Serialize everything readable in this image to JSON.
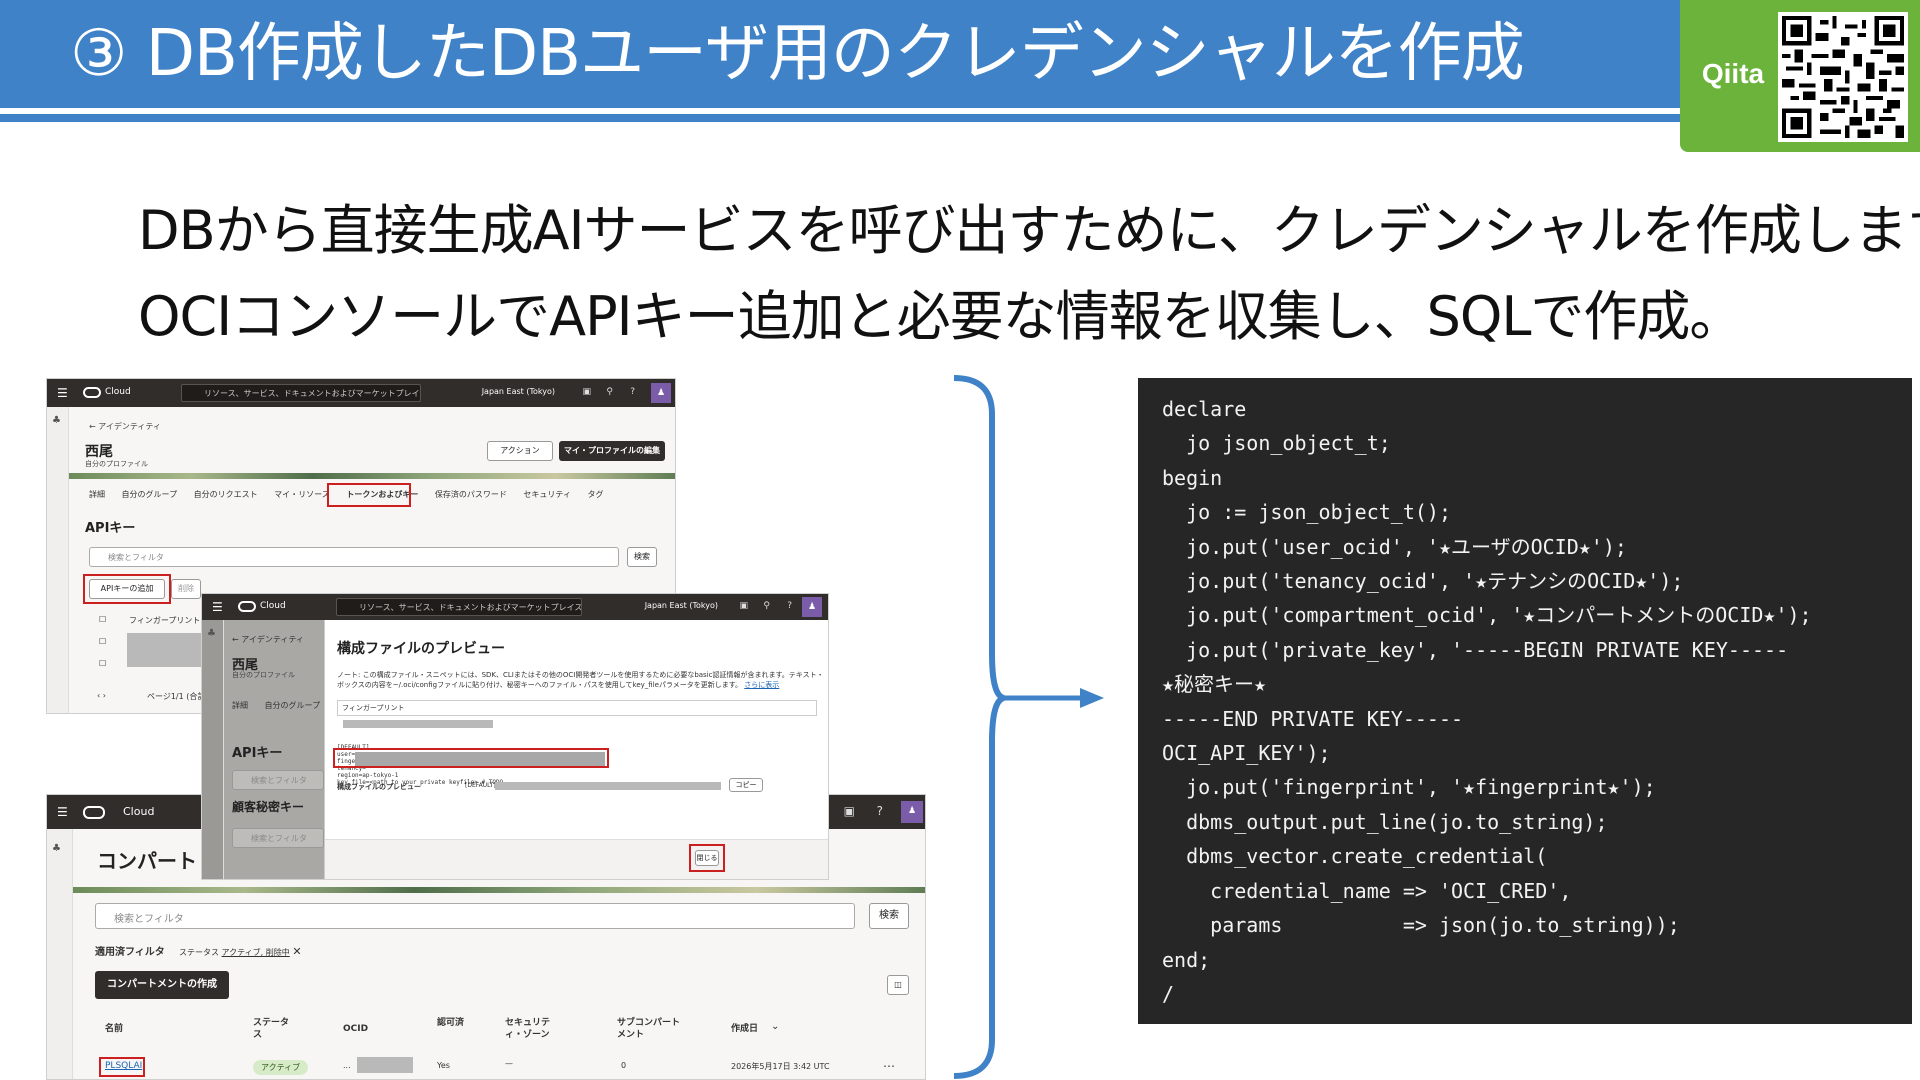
{
  "header": {
    "title": "③ DB作成したDBユーザ用のクレデンシャルを作成",
    "badge_label": "Qiita",
    "qr_icon": "qr-code-icon"
  },
  "lead": {
    "line1": "DBから直接生成AIサービスを呼び出すために、クレデンシャルを作成します。",
    "line2": "OCIコンソールでAPIキー追加と必要な情報を収集し、SQLで作成。"
  },
  "colors": {
    "banner": "#3f82c8",
    "qiita": "#6bb33b",
    "code_bg": "#262626",
    "highlight": "#cc1f1f"
  },
  "console1": {
    "brand": "Cloud",
    "search_placeholder": "リソース、サービス、ドキュメントおよびマーケットプレイス",
    "region": "Japan East (Tokyo)",
    "breadcrumb": "← アイデンティティ",
    "profile_name": "西尾",
    "profile_sub": "自分のプロファイル",
    "actions_button": "アクション",
    "edit_button": "マイ・プロファイルの編集",
    "tabs": [
      "詳細",
      "自分のグループ",
      "自分のリクエスト",
      "マイ・リソース",
      "トークンおよびキー",
      "保存済のパスワード",
      "セキュリティ",
      "タグ"
    ],
    "section_title": "APIキー",
    "filter_placeholder": "検索とフィルタ",
    "search_button": "検索",
    "add_api_key_button": "APIキーの追加",
    "delete_button": "削除",
    "column_fingerprint": "フィンガープリント",
    "pager": "ページ1/1 (合計"
  },
  "console2": {
    "brand": "Cloud",
    "search_placeholder": "リソース、サービス、ドキュメントおよびマーケットプレイス",
    "region": "Japan East (Tokyo)",
    "breadcrumb": "← アイデンティティ",
    "profile_name": "西尾",
    "profile_sub": "自分のプロファイル",
    "tabs": [
      "詳細",
      "自分のグループ"
    ],
    "section_api": "APIキー",
    "section_secret": "顧客秘密キー",
    "filter_placeholder": "検索とフィルタ",
    "modal_title": "構成ファイルのプレビュー",
    "modal_note": "ノート: この構成ファイル・スニペットには、SDK、CLIまたはその他のOCI開発者ツールを使用するために必要なbasic認証情報が含まれます。テキスト・ボックスの内容を~/.oci/configファイルに貼り付け、秘密キーへのファイル・パスを使用してkey_fileパラメータを更新します。",
    "modal_link": "さらに表示",
    "fingerprint_label": "フィンガープリント",
    "config_text": "[DEFAULT]\nuser=\nfingerprint=\ntenancy=\nregion=ap-tokyo-1\nkey_file=<path to your private keyfile> # TODO",
    "preview_label": "構成ファイルのプレビュー",
    "preview_value": "[DEFAULT]",
    "copy_button": "コピー",
    "close_button": "閉じる"
  },
  "console3": {
    "brand": "Cloud",
    "page_title": "コンパート",
    "filter_placeholder": "検索とフィルタ",
    "search_button": "検索",
    "applied_filters": "適用済フィルタ",
    "filter_chip_prefix": "ステータス",
    "filter_chip_value": "アクティブ, 削除中",
    "create_button": "コンパートメントの作成",
    "columns": [
      "名前",
      "ステータス",
      "OCID",
      "認可済",
      "セキュリティ・ゾーン",
      "サブコンパートメント",
      "作成日"
    ],
    "row": {
      "name": "PLSQLAI",
      "status": "アクティブ",
      "ocid": "...",
      "authorized": "Yes",
      "zone": "—",
      "sub": "0",
      "created": "2026年5月17日 3:42 UTC",
      "menu": "⋯"
    }
  },
  "code": {
    "text": "declare\n  jo json_object_t;\nbegin\n  jo := json_object_t();\n  jo.put('user_ocid', '★ユーザのOCID★');\n  jo.put('tenancy_ocid', '★テナンシのOCID★');\n  jo.put('compartment_ocid', '★コンパートメントのOCID★');\n  jo.put('private_key', '-----BEGIN PRIVATE KEY-----\n★秘密キー★\n-----END PRIVATE KEY-----\nOCI_API_KEY');\n  jo.put('fingerprint', '★fingerprint★');\n  dbms_output.put_line(jo.to_string);\n  dbms_vector.create_credential(\n    credential_name => 'OCI_CRED',\n    params          => json(jo.to_string));\nend;\n/"
  }
}
